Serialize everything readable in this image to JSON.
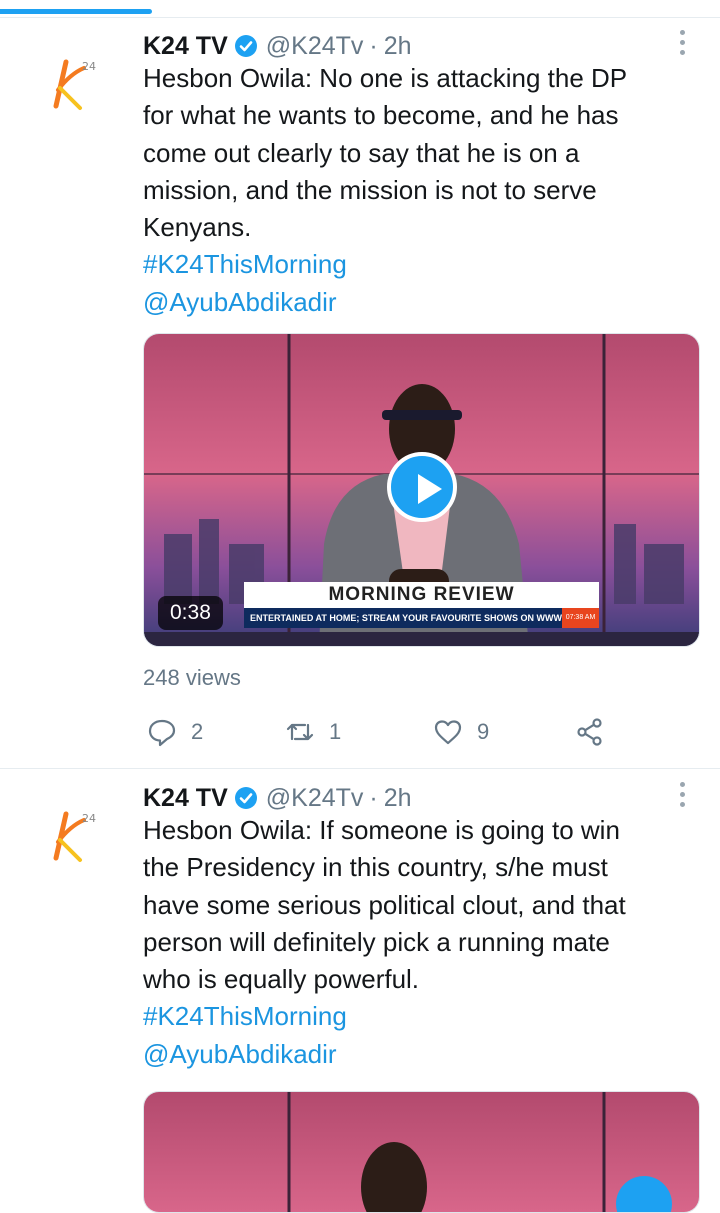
{
  "tweets": [
    {
      "name": "K24 TV",
      "handle": "@K24Tv",
      "separator": "·",
      "time": "2h",
      "text_lines": [
        "Hesbon Owila: No one is attacking the DP",
        "for what he wants to become, and he has",
        "come out clearly to say that he is on a",
        "mission, and the mission is not to serve",
        "Kenyans."
      ],
      "hashtag": "#K24ThisMorning",
      "mention": "@AyubAbdikadir",
      "video": {
        "duration": "0:38",
        "lower_third_title": "MORNING REVIEW",
        "ticker": "ENTERTAINED AT HOME; STREAM YOUR FAVOURITE SHOWS ON WWW.K",
        "clock": "07:38 AM"
      },
      "views": "248 views",
      "replies": "2",
      "retweets": "1",
      "likes": "9"
    },
    {
      "name": "K24 TV",
      "handle": "@K24Tv",
      "separator": "·",
      "time": "2h",
      "text_lines": [
        "Hesbon Owila: If someone is going to win",
        "the Presidency in this country, s/he must",
        "have some serious political clout, and that",
        "person will definitely pick a running mate",
        "who is equally powerful."
      ],
      "hashtag": "#K24ThisMorning",
      "mention": "@AyubAbdikadir"
    }
  ],
  "colors": {
    "accent": "#1da1f2",
    "link": "#1b95e0",
    "muted": "#657786",
    "logo_orange": "#f47b20"
  },
  "icons": [
    "verified-badge-icon",
    "more-options-icon",
    "reply-icon",
    "retweet-icon",
    "like-icon",
    "share-icon",
    "play-icon"
  ]
}
